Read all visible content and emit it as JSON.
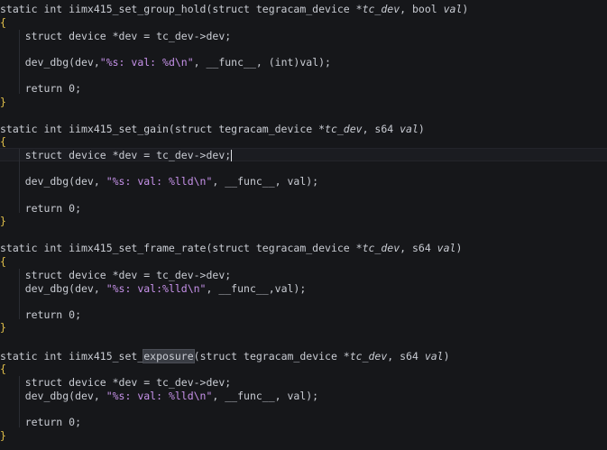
{
  "code": {
    "f1": {
      "sig_pre": "static int iimx415_set_group_hold(struct tegracam_device *",
      "p1": "tc_dev",
      "sig_mid": ", bool ",
      "p2": "val",
      "sig_post": ")",
      "open": "{",
      "l1": "    struct device *dev = tc_dev->dev;",
      "l2_pre": "    dev_dbg(dev,",
      "l2_str": "\"%s: val: %d\\n\"",
      "l2_post": ", __func__, (int)val);",
      "l3": "    return 0;",
      "close": "}"
    },
    "f2": {
      "sig_pre": "static int iimx415_set_gain(struct tegracam_device *",
      "p1": "tc_dev",
      "sig_mid": ", s64 ",
      "p2": "val",
      "sig_post": ")",
      "open": "{",
      "l1": "    struct device *dev = tc_dev->dev;",
      "l2_pre": "    dev_dbg(dev, ",
      "l2_str": "\"%s: val: %lld\\n\"",
      "l2_post": ", __func__, val);",
      "l3": "    return 0;",
      "close": "}"
    },
    "f3": {
      "sig_pre": "static int iimx415_set_frame_rate(struct tegracam_device *",
      "p1": "tc_dev",
      "sig_mid": ", s64 ",
      "p2": "val",
      "sig_post": ")",
      "open": "{",
      "l1": "    struct device *dev = tc_dev->dev;",
      "l2_pre": "    dev_dbg(dev, ",
      "l2_str": "\"%s: val:%lld\\n\"",
      "l2_post": ", __func__,val);",
      "l3": "    return 0;",
      "close": "}"
    },
    "f4": {
      "sig_pre": "static int iimx415_set_",
      "sig_hl": "exposure",
      "sig_pre2": "(struct tegracam_device *",
      "p1": "tc_dev",
      "sig_mid": ", s64 ",
      "p2": "val",
      "sig_post": ")",
      "open": "{",
      "l1": "    struct device *dev = tc_dev->dev;",
      "l2_pre": "    dev_dbg(dev, ",
      "l2_str": "\"%s: val: %lld\\n\"",
      "l2_post": ", __func__, val);",
      "l3": "    return 0;",
      "close": "}"
    }
  }
}
